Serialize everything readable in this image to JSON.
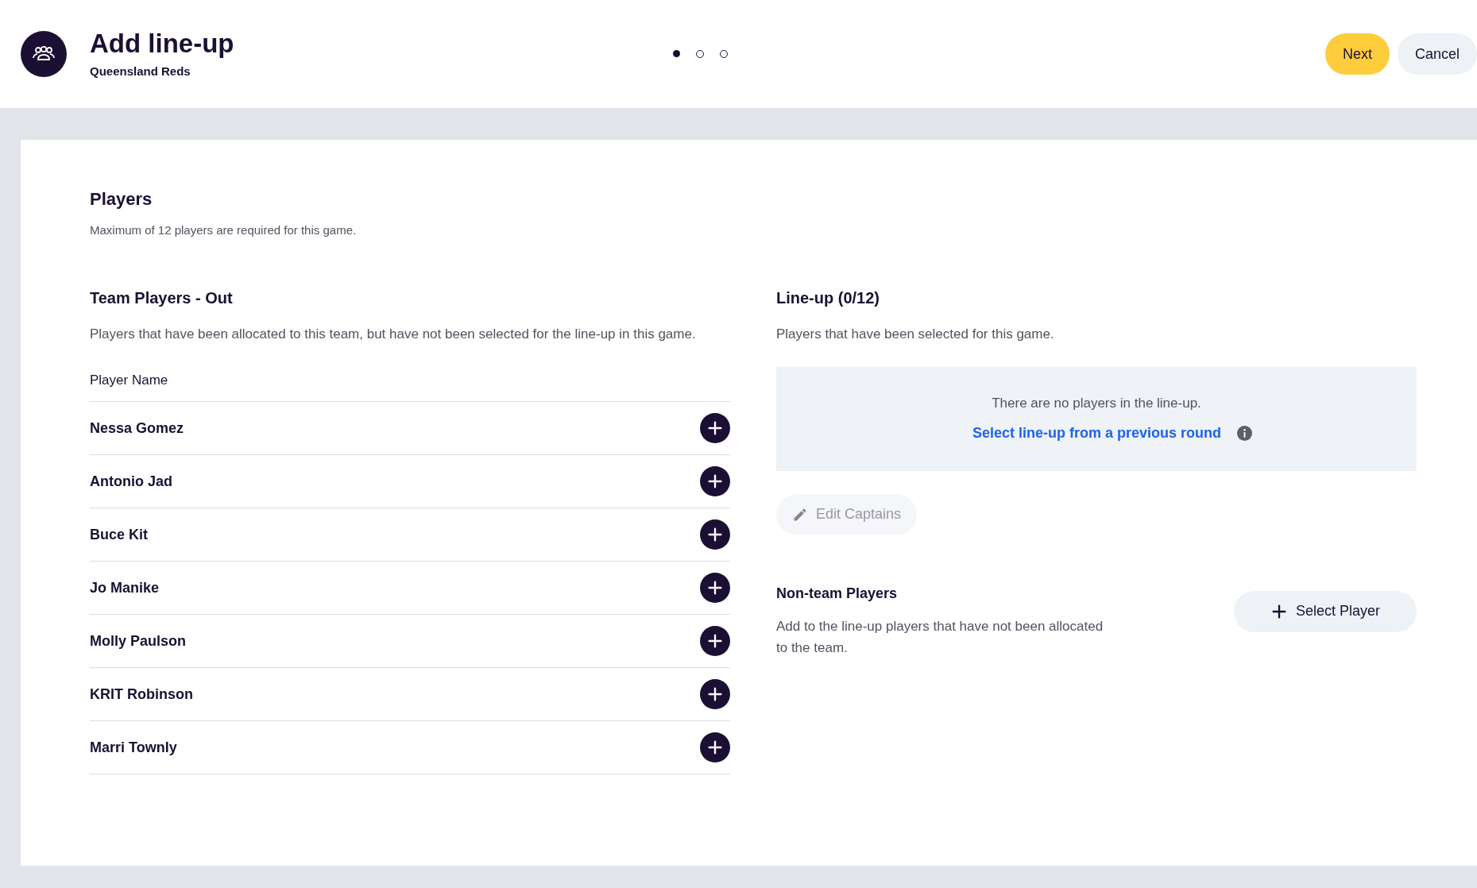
{
  "header": {
    "title": "Add line-up",
    "subtitle": "Queensland Reds",
    "steps": [
      {
        "selected": true
      },
      {
        "selected": false
      },
      {
        "selected": false
      }
    ],
    "buttons": [
      {
        "label": "Next",
        "kind": "primary"
      },
      {
        "label": "Cancel",
        "kind": "secondary"
      }
    ]
  },
  "players": {
    "title": "Players",
    "description": "Maximum of 12 players are required for this game."
  },
  "team_players_out": {
    "title": "Team Players - Out",
    "description": "Players that have been allocated to this team, but have not been selected for the line-up in this game.",
    "column": "Player Name",
    "rows": [
      {
        "name": "Nessa Gomez"
      },
      {
        "name": "Antonio Jad"
      },
      {
        "name": "Buce Kit"
      },
      {
        "name": "Jo Manike"
      },
      {
        "name": "Molly Paulson"
      },
      {
        "name": "KRIT Robinson"
      },
      {
        "name": "Marri Townly"
      }
    ]
  },
  "lineup": {
    "title": "Line-up (0/12)",
    "description": "Players that have been selected for this game.",
    "empty_message": "There are no players in the line-up.",
    "previous_round_link": "Select line-up from a previous round",
    "edit_captains": {
      "label": "Edit Captains",
      "disabled": true
    }
  },
  "non_team_players": {
    "title": "Non-team Players",
    "description": "Add to the line-up players that have not been allocated to the team.",
    "button": "Select Player"
  }
}
